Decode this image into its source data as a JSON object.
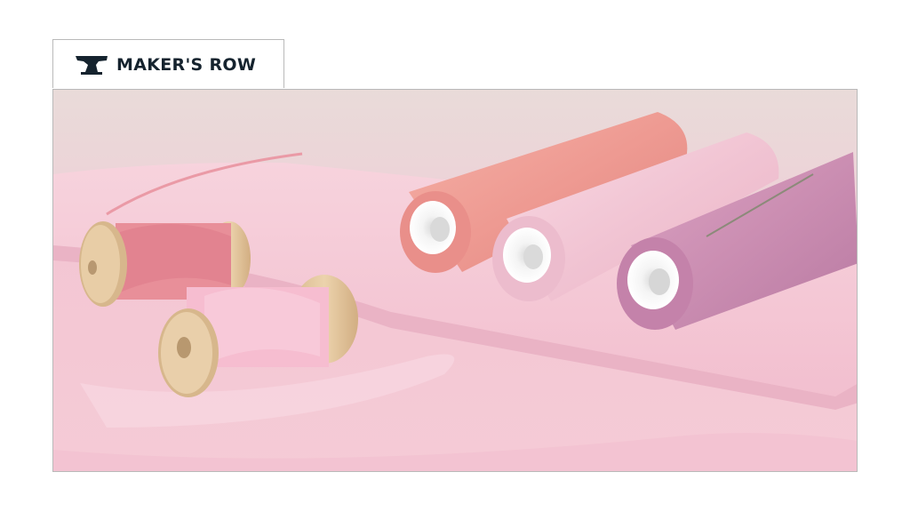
{
  "brand": {
    "name": "MAKER'S ROW",
    "icon": "anvil-icon",
    "color": "#15232e"
  },
  "hero": {
    "image_subject": "photo-thread-spools-ribbon",
    "colors": {
      "background": "#f1cdd6",
      "thread_salmon": "#ef9a92",
      "thread_light_pink": "#f2c6d4",
      "thread_mauve": "#c98bb0",
      "wood": "#e3c8a2"
    }
  }
}
